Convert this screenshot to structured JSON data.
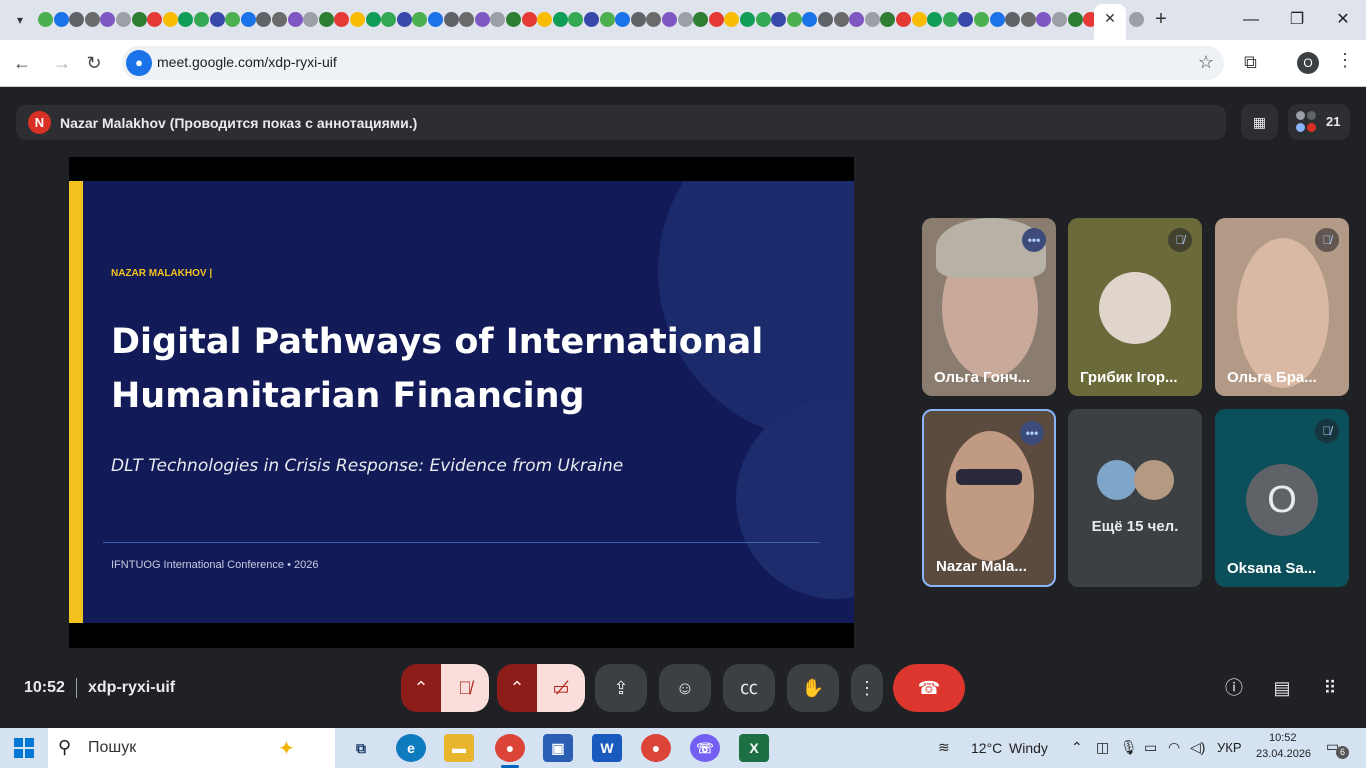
{
  "browser": {
    "url": "meet.google.com/xdp-ryxi-uif",
    "profile_initial": "O"
  },
  "meet": {
    "presenter_initial": "N",
    "presenter_text": "Nazar Malakhov (Проводится показ с аннотациями.)",
    "participant_count": "21",
    "clock": "10:52",
    "meeting_code": "xdp-ryxi-uif"
  },
  "slide": {
    "author": "NAZAR MALAKHOV |",
    "title_line1": "Digital Pathways of International",
    "title_line2": "Humanitarian Financing",
    "subtitle": "DLT Technologies in Crisis Response: Evidence from Ukraine",
    "footer": "IFNTUOG International Conference  •  2026"
  },
  "tiles": [
    {
      "name": "Ольга Гонч...",
      "status": "speaking"
    },
    {
      "name": "Грибик Ігор...",
      "status": "muted"
    },
    {
      "name": "Ольга Бра...",
      "status": "muted"
    },
    {
      "name": "Nazar Mala...",
      "status": "speaking"
    },
    {
      "name": "Ещё 15 чел.",
      "status": "none"
    },
    {
      "name": "Oksana Sa...",
      "avatar_letter": "O",
      "status": "muted"
    }
  ],
  "taskbar": {
    "search_placeholder": "Пошук",
    "weather_temp": "12°C",
    "weather_desc": "Windy",
    "language": "УКР",
    "time": "10:52",
    "date": "23.04.2026",
    "notification_count": "6"
  },
  "colors": {
    "slide_bg": "#121a58",
    "slide_accent": "#f3c21e",
    "end_call": "#dc362e",
    "mic_off": "#f9dedc"
  }
}
